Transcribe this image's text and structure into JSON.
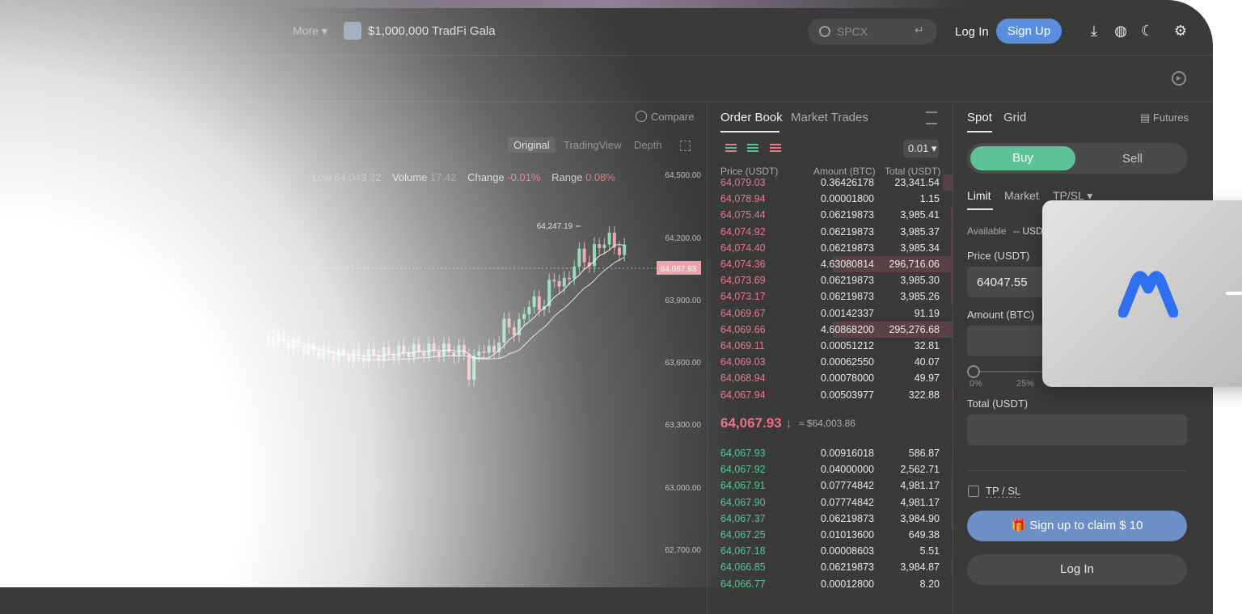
{
  "topbar": {
    "more_label": "More",
    "promo_text": "$1,000,000 TradFi Gala",
    "search_placeholder": "SPCX",
    "search_enter": "↵",
    "login_label": "Log In",
    "signup_label": "Sign Up",
    "icons": [
      "download-icon",
      "globe-icon",
      "moon-icon",
      "gear-icon"
    ]
  },
  "chart": {
    "compare_label": "Compare",
    "tabs": [
      "Original",
      "TradingView",
      "Depth"
    ],
    "stats": {
      "low_label": "Low",
      "low_value": "64,043.32",
      "volume_label": "Volume",
      "volume_value": "17.42",
      "change_label": "Change",
      "change_value": "-0.01%",
      "range_label": "Range",
      "range_value": "0.08%"
    },
    "high_annotation": "64,247.19",
    "price_ticks": [
      "64,500.00",
      "64,200.00",
      "63,900.00",
      "63,600.00",
      "63,300.00",
      "63,000.00",
      "62,700.00"
    ],
    "last_price_tag": "64,067.93"
  },
  "orderbook": {
    "tab_order_book": "Order Book",
    "tab_market_trades": "Market Trades",
    "tick_size": "0.01",
    "header_price": "Price (USDT)",
    "header_amount": "Amount (BTC)",
    "header_total": "Total (USDT)",
    "asks": [
      {
        "price": "64,079.03",
        "amount": "0.36426178",
        "total": "23,341.54"
      },
      {
        "price": "64,078.94",
        "amount": "0.00001800",
        "total": "1.15"
      },
      {
        "price": "64,075.44",
        "amount": "0.06219873",
        "total": "3,985.41"
      },
      {
        "price": "64,074.92",
        "amount": "0.06219873",
        "total": "3,985.37"
      },
      {
        "price": "64,074.40",
        "amount": "0.06219873",
        "total": "3,985.34"
      },
      {
        "price": "64,074.36",
        "amount": "4.63080814",
        "total": "296,716.06"
      },
      {
        "price": "64,073.69",
        "amount": "0.06219873",
        "total": "3,985.30"
      },
      {
        "price": "64,073.17",
        "amount": "0.06219873",
        "total": "3,985.26"
      },
      {
        "price": "64,069.67",
        "amount": "0.00142337",
        "total": "91.19"
      },
      {
        "price": "64,069.66",
        "amount": "4.60868200",
        "total": "295,276.68"
      },
      {
        "price": "64,069.11",
        "amount": "0.00051212",
        "total": "32.81"
      },
      {
        "price": "64,069.03",
        "amount": "0.00062550",
        "total": "40.07"
      },
      {
        "price": "64,068.94",
        "amount": "0.00078000",
        "total": "49.97"
      },
      {
        "price": "64,067.94",
        "amount": "0.00503977",
        "total": "322.88"
      }
    ],
    "mid_price": "64,067.93",
    "mid_arrow": "↓",
    "mid_approx": "≈ $64,003.86",
    "bids": [
      {
        "price": "64,067.93",
        "amount": "0.00916018",
        "total": "586.87"
      },
      {
        "price": "64,067.92",
        "amount": "0.04000000",
        "total": "2,562.71"
      },
      {
        "price": "64,067.91",
        "amount": "0.07774842",
        "total": "4,981.17"
      },
      {
        "price": "64,067.90",
        "amount": "0.07774842",
        "total": "4,981.17"
      },
      {
        "price": "64,067.37",
        "amount": "0.06219873",
        "total": "3,984.90"
      },
      {
        "price": "64,067.25",
        "amount": "0.01013600",
        "total": "649.38"
      },
      {
        "price": "64,067.18",
        "amount": "0.00008603",
        "total": "5.51"
      },
      {
        "price": "64,066.85",
        "amount": "0.06219873",
        "total": "3,984.87"
      },
      {
        "price": "64,066.77",
        "amount": "0.00012800",
        "total": "8.20"
      }
    ]
  },
  "trade": {
    "tab_spot": "Spot",
    "tab_grid": "Grid",
    "futures_label": "Futures",
    "buy_label": "Buy",
    "sell_label": "Sell",
    "order_types": [
      "Limit",
      "Market",
      "TP/SL"
    ],
    "available_label": "Available",
    "available_value": "-- USDT",
    "price_label": "Price (USDT)",
    "price_value": "64047.55",
    "amount_label": "Amount (BTC)",
    "slider_labels": [
      "0%",
      "25%"
    ],
    "total_label": "Total (USDT)",
    "tpsl_label": "TP / SL",
    "claim_label": "Sign up to claim $ 10",
    "login_label": "Log In"
  },
  "colors": {
    "ask": "#e57a8a",
    "bid": "#52c78f",
    "buy": "#5cc494",
    "signup": "#5a8fe0",
    "logo": "#2f6ff0"
  }
}
